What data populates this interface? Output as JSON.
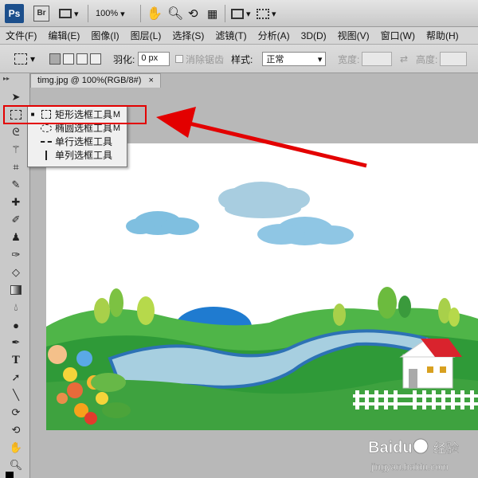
{
  "appbar": {
    "ps_logo": "Ps",
    "br_logo": "Br",
    "zoom": "100%"
  },
  "menu": [
    "文件(F)",
    "编辑(E)",
    "图像(I)",
    "图层(L)",
    "选择(S)",
    "滤镜(T)",
    "分析(A)",
    "3D(D)",
    "视图(V)",
    "窗口(W)",
    "帮助(H)"
  ],
  "options": {
    "feather_label": "羽化:",
    "feather_value": "0 px",
    "antialias_label": "消除锯齿",
    "style_label": "样式:",
    "style_value": "正常",
    "width_label": "宽度:",
    "height_label": "高度:"
  },
  "document": {
    "tab_title": "timg.jpg @ 100%(RGB/8#)",
    "close": "×"
  },
  "flyout": {
    "items": [
      {
        "label": "矩形选框工具",
        "shortcut": "M",
        "active": true,
        "icon": "rect-marquee-icon"
      },
      {
        "label": "椭圆选框工具",
        "shortcut": "M",
        "active": false,
        "icon": "ellipse-marquee-icon"
      },
      {
        "label": "单行选框工具",
        "shortcut": "",
        "active": false,
        "icon": "single-row-marquee-icon"
      },
      {
        "label": "单列选框工具",
        "shortcut": "",
        "active": false,
        "icon": "single-column-marquee-icon"
      }
    ]
  },
  "colors": {
    "highlight": "#e30000",
    "arrow": "#e30000"
  },
  "watermark": {
    "brand": "Bai du 经验",
    "url": "jingyan.baidu.com"
  }
}
